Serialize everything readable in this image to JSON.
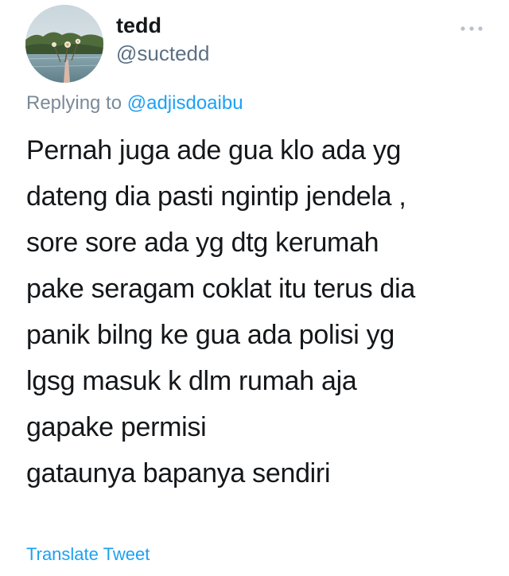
{
  "user": {
    "display_name": "tedd",
    "handle": "@suctedd"
  },
  "icons": {
    "avatar": "avatar-photo",
    "more": "more-options-icon"
  },
  "reply": {
    "prefix": "Replying to ",
    "mention": "@adjisdoaibu"
  },
  "tweet": {
    "lines": [
      "Pernah juga ade gua  klo ada yg",
      "dateng dia pasti ngintip jendela ,",
      "sore sore ada yg dtg kerumah",
      "pake seragam coklat itu terus dia",
      "panik bilng ke gua ada polisi yg",
      "lgsg masuk k dlm rumah aja",
      "gapake permisi",
      "gataunya bapanya sendiri"
    ]
  },
  "actions": {
    "translate_label": "Translate Tweet"
  },
  "colors": {
    "link": "#1da1f2",
    "secondary_text": "#5b7083",
    "primary_text": "#14171a"
  }
}
